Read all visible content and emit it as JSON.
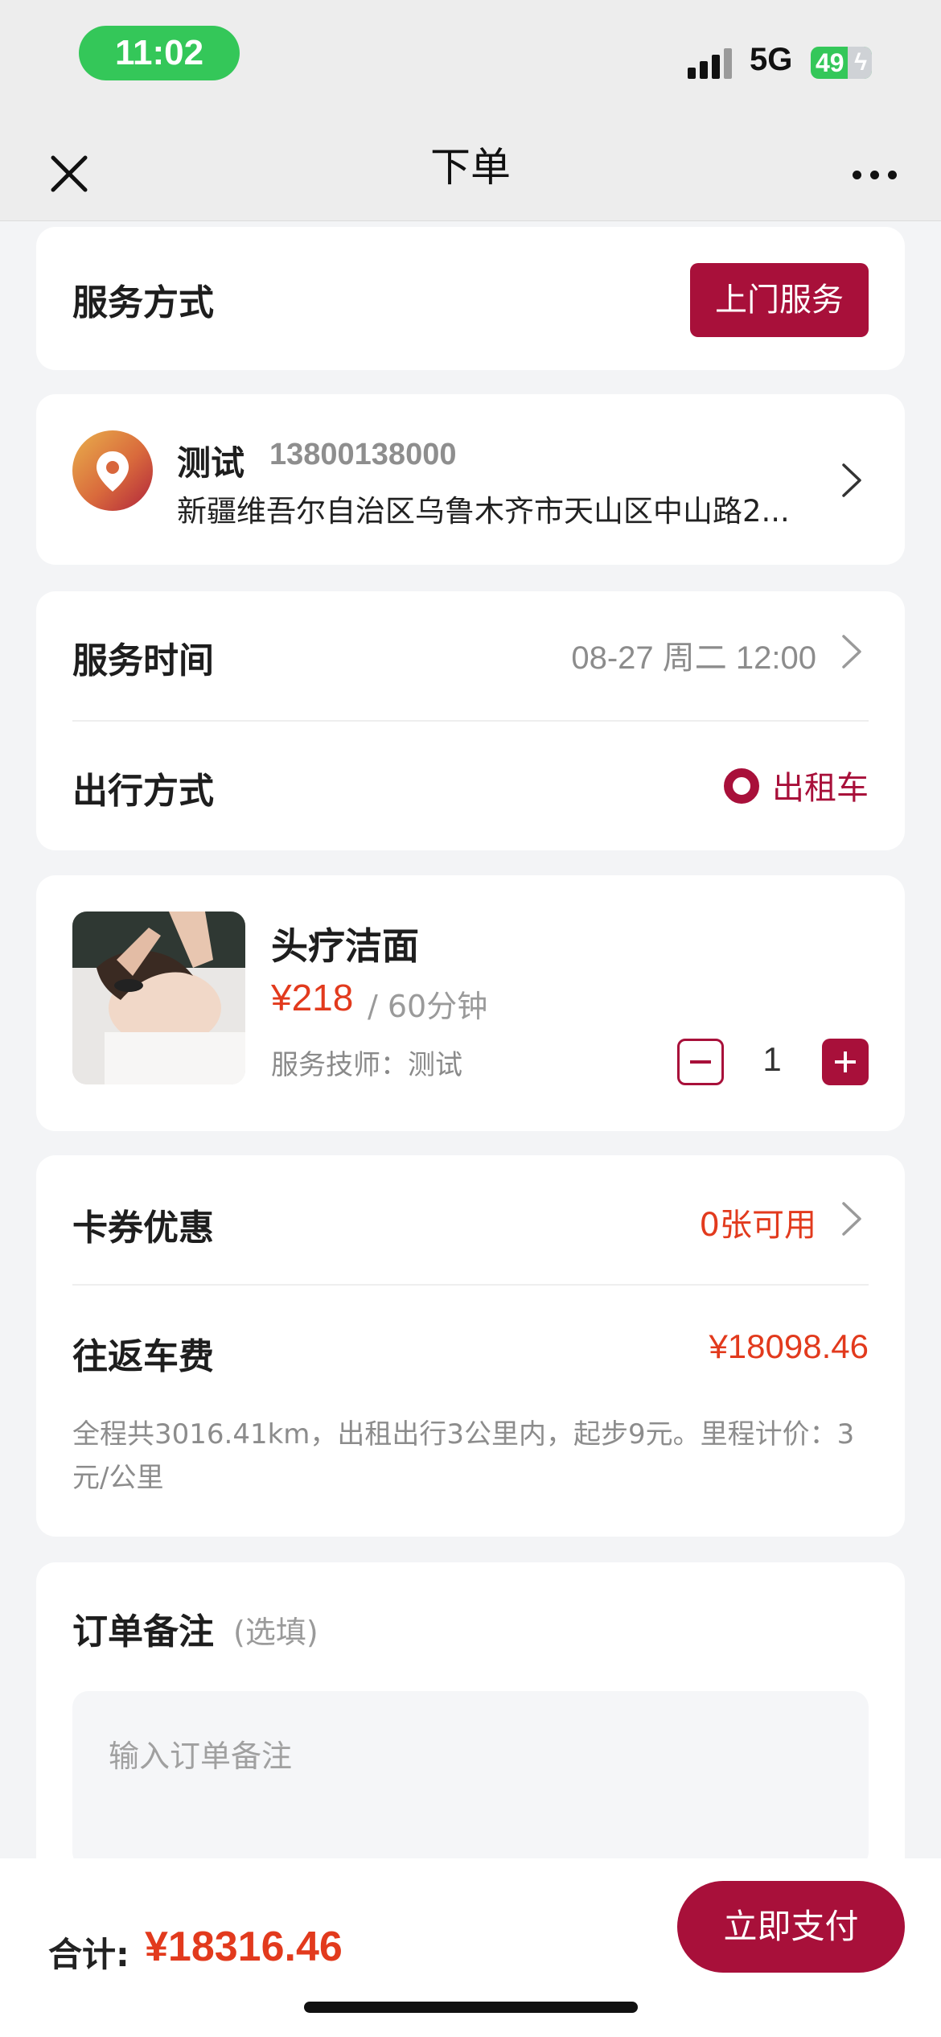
{
  "status_bar": {
    "time": "11:02",
    "network": "5G",
    "battery": "49"
  },
  "nav": {
    "title": "下单",
    "close_icon": "close-icon",
    "more_icon": "more-icon"
  },
  "service_mode": {
    "label": "服务方式",
    "button": "上门服务"
  },
  "address": {
    "name": "测试",
    "phone": "13800138000",
    "line": "新疆维吾尔自治区乌鲁木齐市天山区中山路2..."
  },
  "schedule": {
    "time_label": "服务时间",
    "time_value": "08-27 周二 12:00",
    "travel_label": "出行方式",
    "travel_value": "出租车"
  },
  "service_item": {
    "name": "头疗洁面",
    "price": "¥218",
    "duration": "/ 60分钟",
    "technician": "服务技师：测试",
    "quantity": "1"
  },
  "discount": {
    "coupon_label": "卡券优惠",
    "coupon_value": "0张可用",
    "fare_label": "往返车费",
    "fare_value": "¥18098.46",
    "fare_desc": "全程共3016.41km，出租出行3公里内，起步9元。里程计价：3元/公里"
  },
  "note": {
    "title": "订单备注",
    "optional": "(选填)",
    "placeholder": "输入订单备注"
  },
  "footer": {
    "total_label": "合计:",
    "total_value": "¥18316.46",
    "pay_button": "立即支付"
  },
  "colors": {
    "brand": "#a8103a",
    "price": "#e23a1d",
    "status_green": "#34c759"
  }
}
